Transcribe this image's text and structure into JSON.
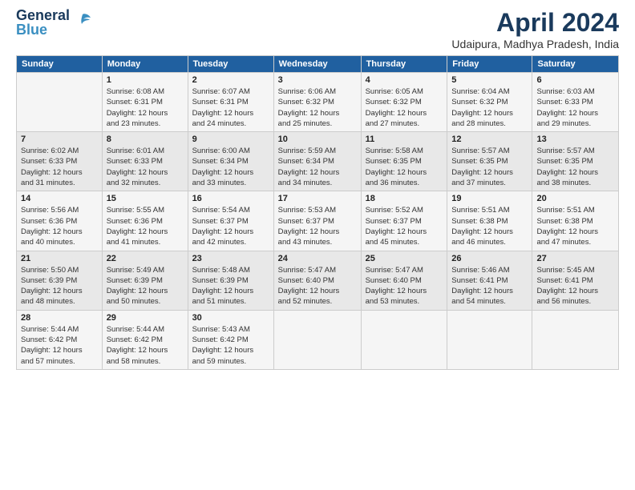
{
  "header": {
    "logo_line1": "General",
    "logo_line2": "Blue",
    "title": "April 2024",
    "subtitle": "Udaipura, Madhya Pradesh, India"
  },
  "calendar": {
    "days_of_week": [
      "Sunday",
      "Monday",
      "Tuesday",
      "Wednesday",
      "Thursday",
      "Friday",
      "Saturday"
    ],
    "weeks": [
      [
        {
          "day": "",
          "info": ""
        },
        {
          "day": "1",
          "info": "Sunrise: 6:08 AM\nSunset: 6:31 PM\nDaylight: 12 hours\nand 23 minutes."
        },
        {
          "day": "2",
          "info": "Sunrise: 6:07 AM\nSunset: 6:31 PM\nDaylight: 12 hours\nand 24 minutes."
        },
        {
          "day": "3",
          "info": "Sunrise: 6:06 AM\nSunset: 6:32 PM\nDaylight: 12 hours\nand 25 minutes."
        },
        {
          "day": "4",
          "info": "Sunrise: 6:05 AM\nSunset: 6:32 PM\nDaylight: 12 hours\nand 27 minutes."
        },
        {
          "day": "5",
          "info": "Sunrise: 6:04 AM\nSunset: 6:32 PM\nDaylight: 12 hours\nand 28 minutes."
        },
        {
          "day": "6",
          "info": "Sunrise: 6:03 AM\nSunset: 6:33 PM\nDaylight: 12 hours\nand 29 minutes."
        }
      ],
      [
        {
          "day": "7",
          "info": "Sunrise: 6:02 AM\nSunset: 6:33 PM\nDaylight: 12 hours\nand 31 minutes."
        },
        {
          "day": "8",
          "info": "Sunrise: 6:01 AM\nSunset: 6:33 PM\nDaylight: 12 hours\nand 32 minutes."
        },
        {
          "day": "9",
          "info": "Sunrise: 6:00 AM\nSunset: 6:34 PM\nDaylight: 12 hours\nand 33 minutes."
        },
        {
          "day": "10",
          "info": "Sunrise: 5:59 AM\nSunset: 6:34 PM\nDaylight: 12 hours\nand 34 minutes."
        },
        {
          "day": "11",
          "info": "Sunrise: 5:58 AM\nSunset: 6:35 PM\nDaylight: 12 hours\nand 36 minutes."
        },
        {
          "day": "12",
          "info": "Sunrise: 5:57 AM\nSunset: 6:35 PM\nDaylight: 12 hours\nand 37 minutes."
        },
        {
          "day": "13",
          "info": "Sunrise: 5:57 AM\nSunset: 6:35 PM\nDaylight: 12 hours\nand 38 minutes."
        }
      ],
      [
        {
          "day": "14",
          "info": "Sunrise: 5:56 AM\nSunset: 6:36 PM\nDaylight: 12 hours\nand 40 minutes."
        },
        {
          "day": "15",
          "info": "Sunrise: 5:55 AM\nSunset: 6:36 PM\nDaylight: 12 hours\nand 41 minutes."
        },
        {
          "day": "16",
          "info": "Sunrise: 5:54 AM\nSunset: 6:37 PM\nDaylight: 12 hours\nand 42 minutes."
        },
        {
          "day": "17",
          "info": "Sunrise: 5:53 AM\nSunset: 6:37 PM\nDaylight: 12 hours\nand 43 minutes."
        },
        {
          "day": "18",
          "info": "Sunrise: 5:52 AM\nSunset: 6:37 PM\nDaylight: 12 hours\nand 45 minutes."
        },
        {
          "day": "19",
          "info": "Sunrise: 5:51 AM\nSunset: 6:38 PM\nDaylight: 12 hours\nand 46 minutes."
        },
        {
          "day": "20",
          "info": "Sunrise: 5:51 AM\nSunset: 6:38 PM\nDaylight: 12 hours\nand 47 minutes."
        }
      ],
      [
        {
          "day": "21",
          "info": "Sunrise: 5:50 AM\nSunset: 6:39 PM\nDaylight: 12 hours\nand 48 minutes."
        },
        {
          "day": "22",
          "info": "Sunrise: 5:49 AM\nSunset: 6:39 PM\nDaylight: 12 hours\nand 50 minutes."
        },
        {
          "day": "23",
          "info": "Sunrise: 5:48 AM\nSunset: 6:39 PM\nDaylight: 12 hours\nand 51 minutes."
        },
        {
          "day": "24",
          "info": "Sunrise: 5:47 AM\nSunset: 6:40 PM\nDaylight: 12 hours\nand 52 minutes."
        },
        {
          "day": "25",
          "info": "Sunrise: 5:47 AM\nSunset: 6:40 PM\nDaylight: 12 hours\nand 53 minutes."
        },
        {
          "day": "26",
          "info": "Sunrise: 5:46 AM\nSunset: 6:41 PM\nDaylight: 12 hours\nand 54 minutes."
        },
        {
          "day": "27",
          "info": "Sunrise: 5:45 AM\nSunset: 6:41 PM\nDaylight: 12 hours\nand 56 minutes."
        }
      ],
      [
        {
          "day": "28",
          "info": "Sunrise: 5:44 AM\nSunset: 6:42 PM\nDaylight: 12 hours\nand 57 minutes."
        },
        {
          "day": "29",
          "info": "Sunrise: 5:44 AM\nSunset: 6:42 PM\nDaylight: 12 hours\nand 58 minutes."
        },
        {
          "day": "30",
          "info": "Sunrise: 5:43 AM\nSunset: 6:42 PM\nDaylight: 12 hours\nand 59 minutes."
        },
        {
          "day": "",
          "info": ""
        },
        {
          "day": "",
          "info": ""
        },
        {
          "day": "",
          "info": ""
        },
        {
          "day": "",
          "info": ""
        }
      ]
    ]
  }
}
